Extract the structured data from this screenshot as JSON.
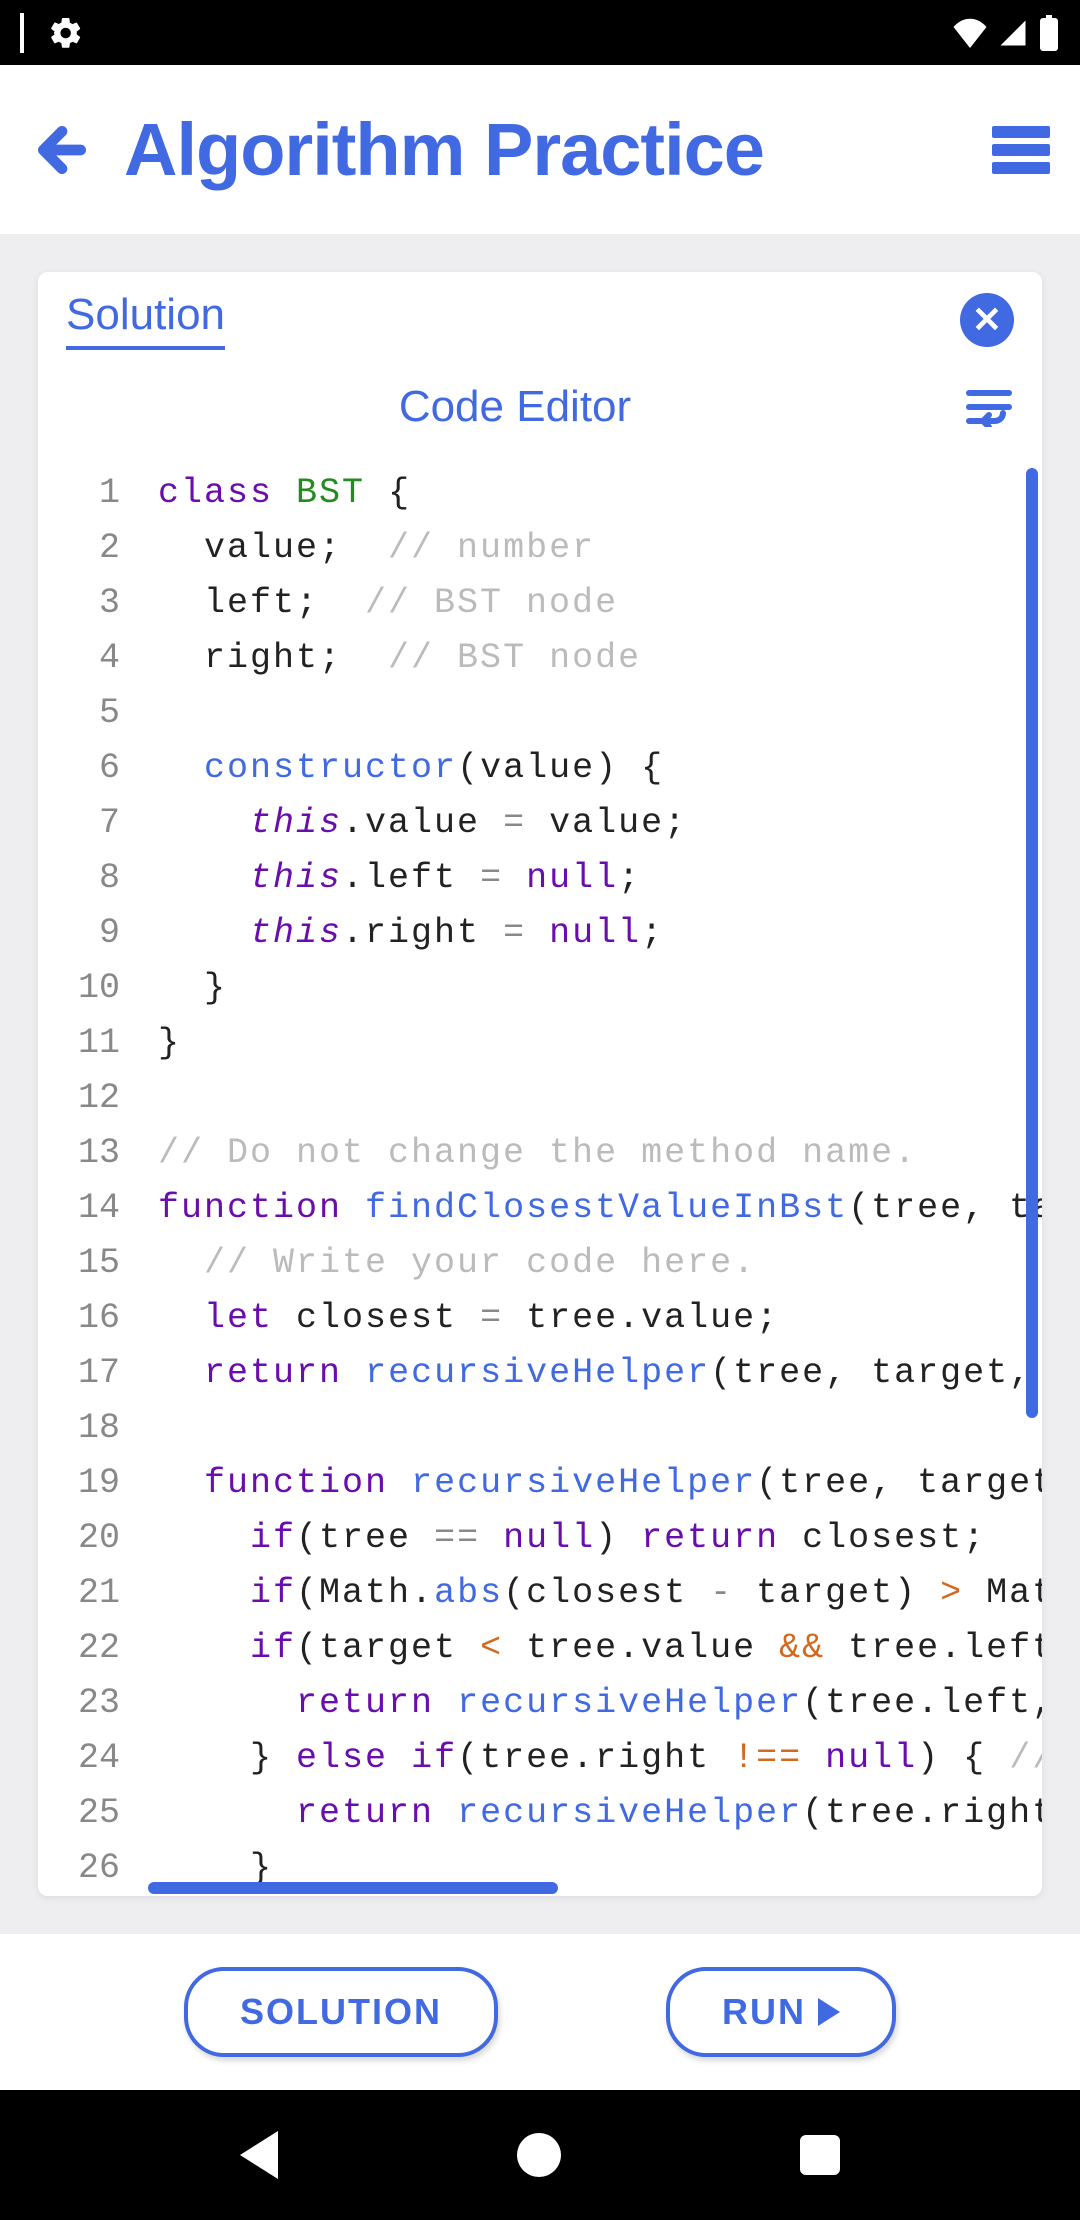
{
  "header": {
    "title": "Algorithm Practice"
  },
  "card": {
    "tab_label": "Solution",
    "editor_title": "Code Editor"
  },
  "buttons": {
    "solution": "SOLUTION",
    "run": "RUN"
  },
  "code": {
    "lines": [
      [
        [
          "kw",
          "class"
        ],
        [
          "txt",
          " "
        ],
        [
          "cls",
          "BST"
        ],
        [
          "txt",
          " {"
        ]
      ],
      [
        [
          "txt",
          "  value;  "
        ],
        [
          "cm",
          "// number"
        ]
      ],
      [
        [
          "txt",
          "  left;  "
        ],
        [
          "cm",
          "// BST node"
        ]
      ],
      [
        [
          "txt",
          "  right;  "
        ],
        [
          "cm",
          "// BST node"
        ]
      ],
      [],
      [
        [
          "txt",
          "  "
        ],
        [
          "fn",
          "constructor"
        ],
        [
          "txt",
          "(value) {"
        ]
      ],
      [
        [
          "txt",
          "    "
        ],
        [
          "this",
          "this"
        ],
        [
          "txt",
          ".value "
        ],
        [
          "op",
          "="
        ],
        [
          "txt",
          " value;"
        ]
      ],
      [
        [
          "txt",
          "    "
        ],
        [
          "this",
          "this"
        ],
        [
          "txt",
          ".left "
        ],
        [
          "op",
          "="
        ],
        [
          "txt",
          " "
        ],
        [
          "nl",
          "null"
        ],
        [
          "txt",
          ";"
        ]
      ],
      [
        [
          "txt",
          "    "
        ],
        [
          "this",
          "this"
        ],
        [
          "txt",
          ".right "
        ],
        [
          "op",
          "="
        ],
        [
          "txt",
          " "
        ],
        [
          "nl",
          "null"
        ],
        [
          "txt",
          ";"
        ]
      ],
      [
        [
          "txt",
          "  }"
        ]
      ],
      [
        [
          "txt",
          "}"
        ]
      ],
      [],
      [
        [
          "cm",
          "// Do not change the method name."
        ]
      ],
      [
        [
          "kw",
          "function"
        ],
        [
          "txt",
          " "
        ],
        [
          "fn",
          "findClosestValueInBst"
        ],
        [
          "txt",
          "(tree, tar"
        ]
      ],
      [
        [
          "txt",
          "  "
        ],
        [
          "cm",
          "// Write your code here."
        ]
      ],
      [
        [
          "txt",
          "  "
        ],
        [
          "let",
          "let"
        ],
        [
          "txt",
          " closest "
        ],
        [
          "op",
          "="
        ],
        [
          "txt",
          " tree.value;"
        ]
      ],
      [
        [
          "txt",
          "  "
        ],
        [
          "kw",
          "return"
        ],
        [
          "txt",
          " "
        ],
        [
          "fn",
          "recursiveHelper"
        ],
        [
          "txt",
          "(tree, target, c"
        ]
      ],
      [],
      [
        [
          "txt",
          "  "
        ],
        [
          "kw",
          "function"
        ],
        [
          "txt",
          " "
        ],
        [
          "fn",
          "recursiveHelper"
        ],
        [
          "txt",
          "(tree, target,"
        ]
      ],
      [
        [
          "txt",
          "    "
        ],
        [
          "kw",
          "if"
        ],
        [
          "txt",
          "(tree "
        ],
        [
          "op",
          "=="
        ],
        [
          "txt",
          " "
        ],
        [
          "nl",
          "null"
        ],
        [
          "txt",
          ") "
        ],
        [
          "kw",
          "return"
        ],
        [
          "txt",
          " closest;"
        ]
      ],
      [
        [
          "txt",
          "    "
        ],
        [
          "kw",
          "if"
        ],
        [
          "txt",
          "(Math."
        ],
        [
          "fn",
          "abs"
        ],
        [
          "txt",
          "(closest "
        ],
        [
          "op",
          "-"
        ],
        [
          "txt",
          " target) "
        ],
        [
          "op2",
          ">"
        ],
        [
          "txt",
          " Math"
        ]
      ],
      [
        [
          "txt",
          "    "
        ],
        [
          "kw",
          "if"
        ],
        [
          "txt",
          "(target "
        ],
        [
          "op2",
          "<"
        ],
        [
          "txt",
          " tree.value "
        ],
        [
          "op2",
          "&&"
        ],
        [
          "txt",
          " tree.left "
        ]
      ],
      [
        [
          "txt",
          "      "
        ],
        [
          "kw",
          "return"
        ],
        [
          "txt",
          " "
        ],
        [
          "fn",
          "recursiveHelper"
        ],
        [
          "txt",
          "(tree.left, "
        ]
      ],
      [
        [
          "txt",
          "    } "
        ],
        [
          "kw",
          "else"
        ],
        [
          "txt",
          " "
        ],
        [
          "kw",
          "if"
        ],
        [
          "txt",
          "(tree.right "
        ],
        [
          "op2",
          "!=="
        ],
        [
          "txt",
          " "
        ],
        [
          "nl",
          "null"
        ],
        [
          "txt",
          ") { "
        ],
        [
          "cm",
          "//g"
        ]
      ],
      [
        [
          "txt",
          "      "
        ],
        [
          "kw",
          "return"
        ],
        [
          "txt",
          " "
        ],
        [
          "fn",
          "recursiveHelper"
        ],
        [
          "txt",
          "(tree.right,"
        ]
      ],
      [
        [
          "txt",
          "    }"
        ]
      ]
    ]
  }
}
